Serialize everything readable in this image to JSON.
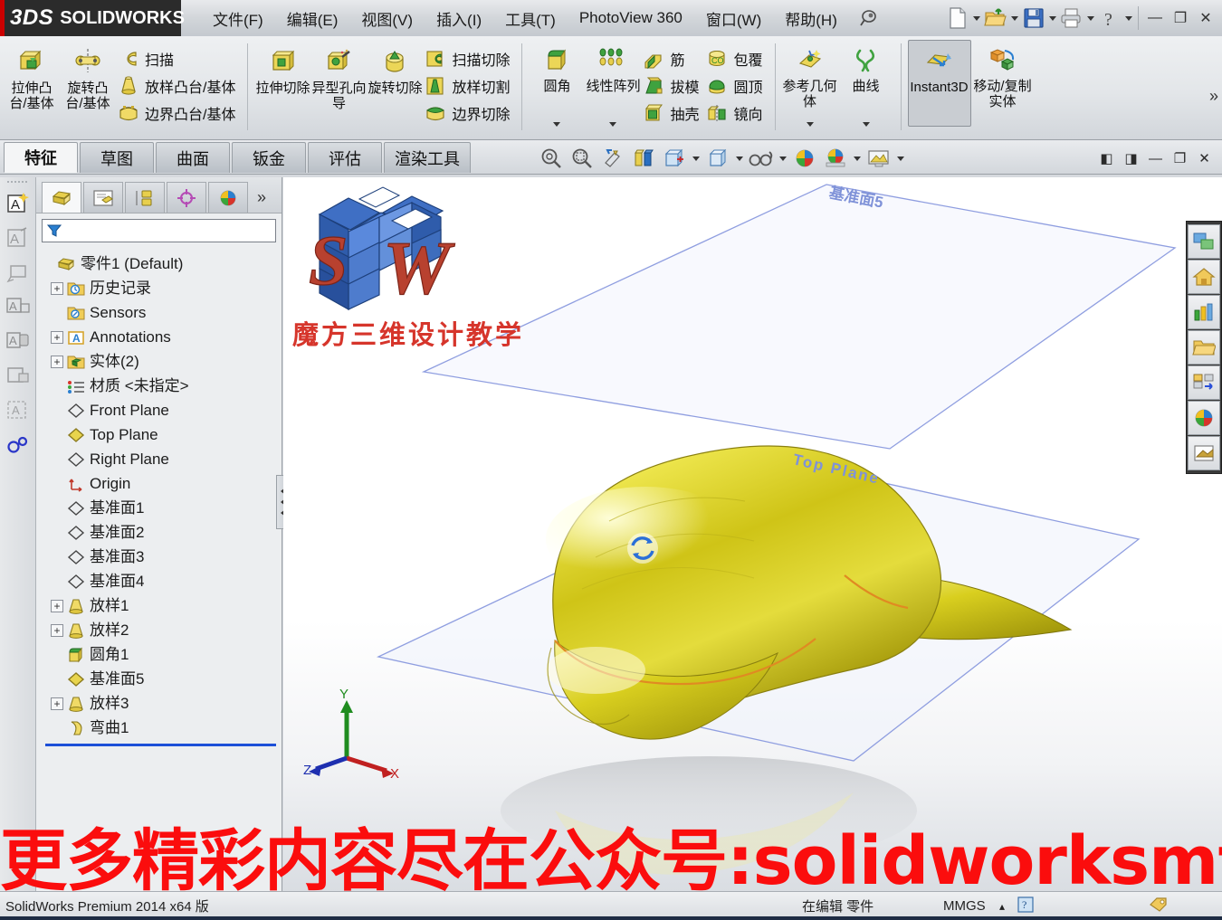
{
  "app": {
    "brand_ds": "3DS",
    "brand_name": "SOLIDWORKS",
    "accent_red": "#cc0000",
    "accent_blue": "#1c4fd8"
  },
  "menu": {
    "items": [
      {
        "label": "文件(F)",
        "name": "menu-file"
      },
      {
        "label": "编辑(E)",
        "name": "menu-edit"
      },
      {
        "label": "视图(V)",
        "name": "menu-view"
      },
      {
        "label": "插入(I)",
        "name": "menu-insert"
      },
      {
        "label": "工具(T)",
        "name": "menu-tools"
      },
      {
        "label": "PhotoView 360",
        "name": "menu-photoview"
      },
      {
        "label": "窗口(W)",
        "name": "menu-window"
      },
      {
        "label": "帮助(H)",
        "name": "menu-help"
      }
    ],
    "pin_icon": "pushpin-icon"
  },
  "quick_access": {
    "buttons": [
      {
        "name": "new-document-button",
        "icon": "new-document-icon",
        "caret": true
      },
      {
        "name": "open-document-button",
        "icon": "open-folder-icon",
        "caret": true
      },
      {
        "name": "save-button",
        "icon": "floppy-disk-icon",
        "caret": true
      },
      {
        "name": "print-button",
        "icon": "printer-icon",
        "caret": true
      },
      {
        "name": "help-button",
        "icon": "question-mark-icon",
        "caret": true
      }
    ],
    "window": {
      "minimize": "—",
      "restore": "❐",
      "close": "✕"
    }
  },
  "ribbon": {
    "groups": [
      {
        "name": "boss-base-group",
        "big": [
          {
            "label": "拉伸凸台/基体",
            "icon": "extrude-boss-icon",
            "name": "extruded-boss-base-button"
          },
          {
            "label": "旋转凸台/基体",
            "icon": "revolve-boss-icon",
            "name": "revolved-boss-base-button"
          }
        ],
        "small": [
          {
            "label": "扫描",
            "icon": "sweep-icon",
            "name": "swept-boss-base-button"
          },
          {
            "label": "放样凸台/基体",
            "icon": "loft-icon",
            "name": "lofted-boss-base-button"
          },
          {
            "label": "边界凸台/基体",
            "icon": "boundary-icon",
            "name": "boundary-boss-base-button"
          }
        ]
      },
      {
        "name": "cut-group",
        "big": [
          {
            "label": "拉伸切除",
            "icon": "extrude-cut-icon",
            "name": "extruded-cut-button"
          },
          {
            "label": "异型孔向导",
            "icon": "hole-wizard-icon",
            "name": "hole-wizard-button"
          },
          {
            "label": "旋转切除",
            "icon": "revolve-cut-icon",
            "name": "revolved-cut-button"
          }
        ],
        "small": [
          {
            "label": "扫描切除",
            "icon": "sweep-cut-icon",
            "name": "swept-cut-button"
          },
          {
            "label": "放样切割",
            "icon": "loft-cut-icon",
            "name": "lofted-cut-button"
          },
          {
            "label": "边界切除",
            "icon": "boundary-cut-icon",
            "name": "boundary-cut-button"
          }
        ]
      },
      {
        "name": "feature-group",
        "big": [
          {
            "label": "圆角",
            "icon": "fillet-icon",
            "name": "fillet-button",
            "caret": true
          },
          {
            "label": "线性阵列",
            "icon": "linear-pattern-icon",
            "name": "linear-pattern-button",
            "caret": true
          }
        ],
        "small": [
          {
            "label": "筋",
            "icon": "rib-icon",
            "name": "rib-button"
          },
          {
            "label": "拔模",
            "icon": "draft-icon",
            "name": "draft-button"
          },
          {
            "label": "抽壳",
            "icon": "shell-icon",
            "name": "shell-button"
          }
        ],
        "small2": [
          {
            "label": "包覆",
            "icon": "wrap-icon",
            "name": "wrap-button"
          },
          {
            "label": "圆顶",
            "icon": "dome-icon",
            "name": "dome-button"
          },
          {
            "label": "镜向",
            "icon": "mirror-icon",
            "name": "mirror-button"
          }
        ]
      },
      {
        "name": "reference-group",
        "big": [
          {
            "label": "参考几何体",
            "icon": "reference-geometry-icon",
            "name": "reference-geometry-button",
            "caret": true
          },
          {
            "label": "曲线",
            "icon": "curves-icon",
            "name": "curves-button",
            "caret": true
          }
        ]
      },
      {
        "name": "instant3d-group",
        "big": [
          {
            "label": "Instant3D",
            "icon": "instant3d-icon",
            "name": "instant3d-button",
            "selected": true
          },
          {
            "label": "移动/复制实体",
            "icon": "move-copy-bodies-icon",
            "name": "move-copy-bodies-button"
          }
        ]
      }
    ],
    "overflow": "»"
  },
  "tabs": {
    "items": [
      {
        "label": "特征",
        "name": "tab-features",
        "active": true
      },
      {
        "label": "草图",
        "name": "tab-sketch",
        "active": false
      },
      {
        "label": "曲面",
        "name": "tab-surfaces",
        "active": false
      },
      {
        "label": "钣金",
        "name": "tab-sheetmetal",
        "active": false
      },
      {
        "label": "评估",
        "name": "tab-evaluate",
        "active": false
      },
      {
        "label": "渲染工具",
        "name": "tab-render-tools",
        "active": false
      }
    ]
  },
  "view_toolbar": {
    "buttons": [
      {
        "name": "zoom-to-fit-button",
        "icon": "zoom-fit-icon"
      },
      {
        "name": "zoom-to-area-button",
        "icon": "zoom-area-icon"
      },
      {
        "name": "previous-view-button",
        "icon": "previous-view-icon"
      },
      {
        "name": "section-view-button",
        "icon": "section-view-icon"
      },
      {
        "name": "view-orientation-button",
        "icon": "view-orientation-icon",
        "caret": true
      },
      {
        "name": "display-style-button",
        "icon": "display-style-icon",
        "caret": true
      },
      {
        "name": "hide-show-items-button",
        "icon": "glasses-icon",
        "caret": true
      },
      {
        "name": "edit-appearance-button",
        "icon": "appearance-sphere-icon"
      },
      {
        "name": "apply-scene-button",
        "icon": "scene-icon",
        "caret": true
      },
      {
        "name": "view-settings-button",
        "icon": "view-settings-icon",
        "caret": true
      }
    ],
    "window_controls": [
      {
        "name": "restore-left-button",
        "glyph": "◧"
      },
      {
        "name": "restore-right-button",
        "glyph": "◨"
      },
      {
        "name": "doc-minimize-button",
        "glyph": "—"
      },
      {
        "name": "doc-restore-button",
        "glyph": "❐"
      },
      {
        "name": "doc-close-button",
        "glyph": "✕"
      }
    ]
  },
  "left_toolbar": {
    "buttons": [
      {
        "name": "new-sketch-button",
        "icon": "new-sketch-icon"
      },
      {
        "name": "smart-dimension-button",
        "icon": "smart-dimension-icon"
      },
      {
        "name": "note-button",
        "icon": "note-icon"
      },
      {
        "name": "model-items-button",
        "icon": "model-items-icon"
      },
      {
        "name": "sketch-tools-button",
        "icon": "sketch-tools-icon"
      },
      {
        "name": "lock-sketch-button",
        "icon": "lock-sketch-icon"
      },
      {
        "name": "area-hatch-button",
        "icon": "area-hatch-icon"
      },
      {
        "name": "display-delete-relations-button",
        "icon": "relations-icon"
      }
    ]
  },
  "tree_panel": {
    "tabs": [
      {
        "name": "feature-manager-tab",
        "icon": "feature-tree-icon",
        "active": true
      },
      {
        "name": "property-manager-tab",
        "icon": "property-manager-icon",
        "active": false
      },
      {
        "name": "configuration-manager-tab",
        "icon": "configuration-icon",
        "active": false
      },
      {
        "name": "dimxpert-manager-tab",
        "icon": "dimxpert-icon",
        "active": false
      },
      {
        "name": "display-manager-tab",
        "icon": "display-manager-icon",
        "active": false
      }
    ],
    "more": "»",
    "filter": {
      "name": "tree-filter-input",
      "value": "",
      "placeholder": "",
      "icon": "filter-funnel-icon"
    },
    "root": {
      "label": "零件1  (Default)",
      "icon": "part-icon"
    },
    "items": [
      {
        "label": "历史记录",
        "icon": "history-folder-icon",
        "expandable": true,
        "name": "tree-item-history"
      },
      {
        "label": "Sensors",
        "icon": "sensors-folder-icon",
        "expandable": false,
        "name": "tree-item-sensors"
      },
      {
        "label": "Annotations",
        "icon": "annotations-folder-icon",
        "expandable": true,
        "name": "tree-item-annotations"
      },
      {
        "label": "实体(2)",
        "icon": "solid-bodies-folder-icon",
        "expandable": true,
        "name": "tree-item-solid-bodies"
      },
      {
        "label": "材质 <未指定>",
        "icon": "material-icon",
        "expandable": false,
        "name": "tree-item-material"
      },
      {
        "label": "Front Plane",
        "icon": "plane-icon",
        "expandable": false,
        "name": "tree-item-front-plane"
      },
      {
        "label": "Top Plane",
        "icon": "plane-highlight-icon",
        "expandable": false,
        "name": "tree-item-top-plane"
      },
      {
        "label": "Right Plane",
        "icon": "plane-icon",
        "expandable": false,
        "name": "tree-item-right-plane"
      },
      {
        "label": "Origin",
        "icon": "origin-icon",
        "expandable": false,
        "name": "tree-item-origin"
      },
      {
        "label": "基准面1",
        "icon": "plane-icon",
        "expandable": false,
        "name": "tree-item-plane1"
      },
      {
        "label": "基准面2",
        "icon": "plane-icon",
        "expandable": false,
        "name": "tree-item-plane2"
      },
      {
        "label": "基准面3",
        "icon": "plane-icon",
        "expandable": false,
        "name": "tree-item-plane3"
      },
      {
        "label": "基准面4",
        "icon": "plane-icon",
        "expandable": false,
        "name": "tree-item-plane4"
      },
      {
        "label": "放样1",
        "icon": "loft-feature-icon",
        "expandable": true,
        "name": "tree-item-loft1"
      },
      {
        "label": "放样2",
        "icon": "loft-feature-icon",
        "expandable": true,
        "name": "tree-item-loft2"
      },
      {
        "label": "圆角1",
        "icon": "fillet-feature-icon",
        "expandable": false,
        "name": "tree-item-fillet1"
      },
      {
        "label": "基准面5",
        "icon": "plane-highlight-icon",
        "expandable": false,
        "name": "tree-item-plane5"
      },
      {
        "label": "放样3",
        "icon": "loft-feature-icon",
        "expandable": true,
        "name": "tree-item-loft3"
      },
      {
        "label": "弯曲1",
        "icon": "flex-feature-icon",
        "expandable": false,
        "name": "tree-item-flex1"
      }
    ]
  },
  "viewport": {
    "logo": {
      "letters": "SW",
      "caption": "魔方三维设计教学"
    },
    "plane_labels": [
      {
        "text": "基准面5",
        "name": "plane-label-plane5"
      },
      {
        "text": "Top Plane",
        "name": "plane-label-top-plane"
      }
    ],
    "triad": {
      "x": "X",
      "y": "Y",
      "z": "Z"
    },
    "model_color": "#d4cc16",
    "rotate_handle_icon": "rotate-handle-icon"
  },
  "right_toolbar": {
    "buttons": [
      {
        "name": "task-pane-sw-resources-button",
        "icon": "sw-resources-icon"
      },
      {
        "name": "task-pane-home-button",
        "icon": "home-icon"
      },
      {
        "name": "task-pane-design-library-button",
        "icon": "design-library-icon"
      },
      {
        "name": "task-pane-file-explorer-button",
        "icon": "file-explorer-icon"
      },
      {
        "name": "task-pane-view-palette-button",
        "icon": "view-palette-icon"
      },
      {
        "name": "task-pane-appearances-button",
        "icon": "appearances-scenes-icon"
      },
      {
        "name": "task-pane-custom-properties-button",
        "icon": "custom-properties-icon"
      }
    ]
  },
  "watermark": {
    "text": "更多精彩内容尽在公众号:solidworksmfy",
    "color": "#fb0d0d"
  },
  "statusbar": {
    "product": "SolidWorks Premium 2014 x64 版",
    "edit_state": "在编辑 零件",
    "units": "MMGS",
    "units_caret": "▴",
    "help_icon": "question-help-icon",
    "tag_icon": "tag-icon"
  }
}
